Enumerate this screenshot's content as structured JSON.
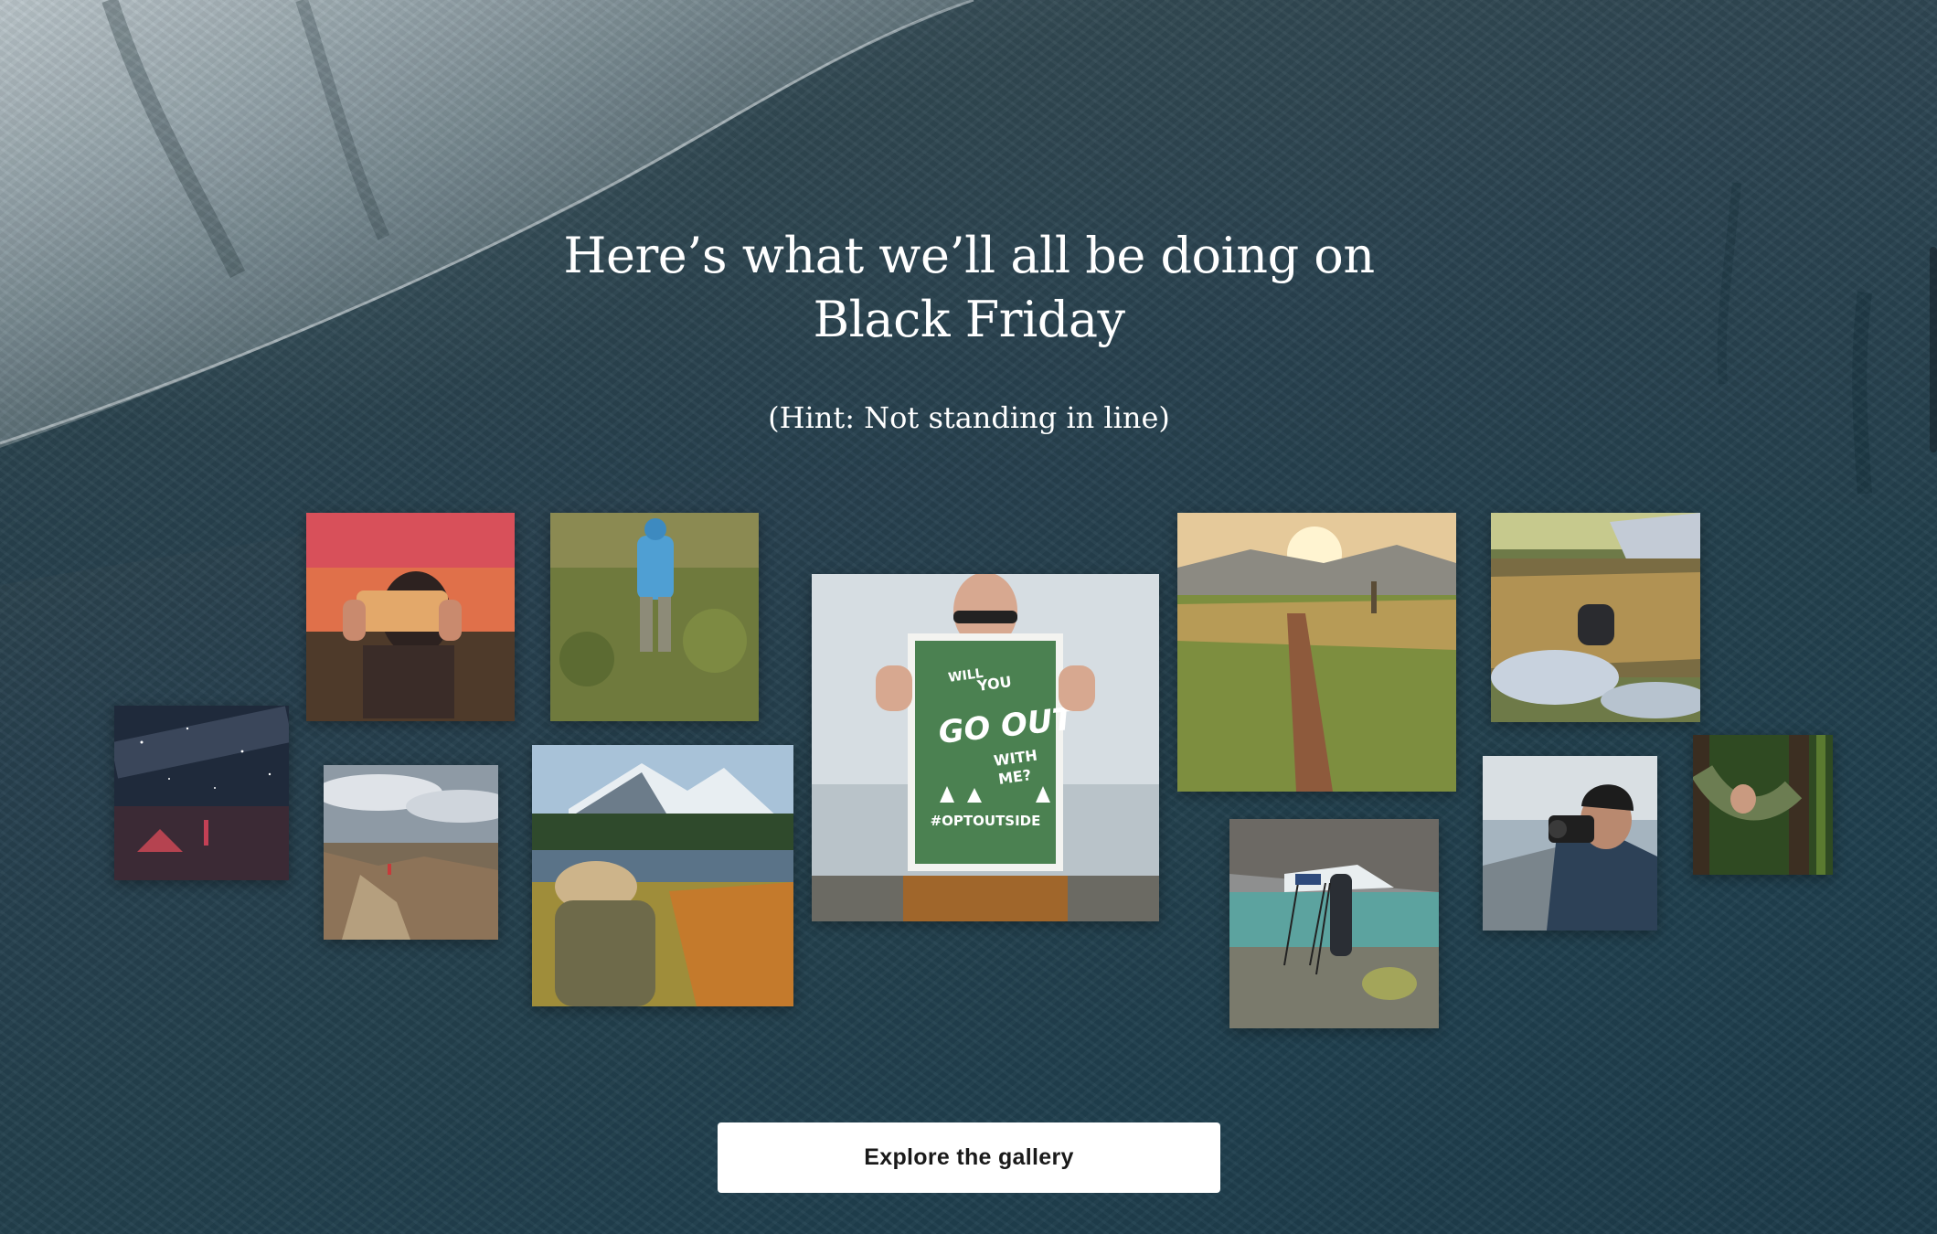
{
  "hero": {
    "headline_line1": "Here’s what we’ll all be doing on",
    "headline_line2": "Black Friday",
    "hint": "(Hint: Not standing in line)"
  },
  "gallery": {
    "photos": [
      {
        "subject": "night sky camp with milky way"
      },
      {
        "subject": "person photographing sunset with phone"
      },
      {
        "subject": "person standing on canyon overlook"
      },
      {
        "subject": "hiker in blue jacket in meadow"
      },
      {
        "subject": "photographer at alpine lake with mountain"
      },
      {
        "subject": "woman holding sign",
        "sign_text": [
          "WILL",
          "YOU",
          "GO OUT",
          "WITH",
          "ME?",
          "#OPTOUTSIDE"
        ]
      },
      {
        "subject": "trail through grassy hills at sunset"
      },
      {
        "subject": "person with tripod at glacier lake"
      },
      {
        "subject": "photographer crouching by stream"
      },
      {
        "subject": "bearded photographer with camera"
      },
      {
        "subject": "person relaxing in hammock in forest"
      }
    ]
  },
  "cta": {
    "label": "Explore the gallery"
  },
  "colors": {
    "background": "#24414e",
    "text": "#ffffff",
    "button_bg": "#ffffff",
    "button_text": "#1a1a1a"
  }
}
